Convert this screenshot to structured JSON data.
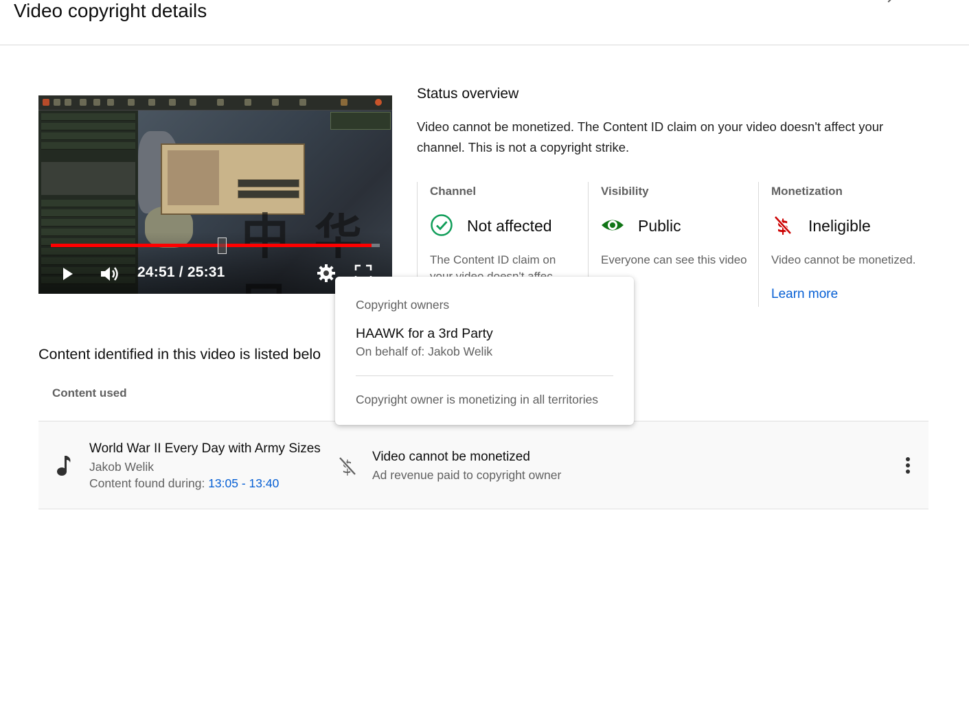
{
  "header": {
    "title": "Video copyright details"
  },
  "player": {
    "time_display": "24:51 / 25:31",
    "progress_fraction": 0.974,
    "handle_fraction": 0.52,
    "map_overlay_text": "中 华 民"
  },
  "status": {
    "title": "Status overview",
    "description": "Video cannot be monetized. The Content ID claim on your video doesn't affect your channel. This is not a copyright strike.",
    "columns": [
      {
        "label": "Channel",
        "value": "Not affected",
        "icon": "check-circle-icon",
        "color": "#0f9d58",
        "description": "The Content ID claim on your video doesn't affec"
      },
      {
        "label": "Visibility",
        "value": "Public",
        "icon": "eye-icon",
        "color": "#107516",
        "description": "Everyone can see this video"
      },
      {
        "label": "Monetization",
        "value": "Ineligible",
        "icon": "no-money-icon",
        "color": "#cc0000",
        "description": "Video cannot be monetized.",
        "link": "Learn more"
      }
    ]
  },
  "content": {
    "heading": "Content identified in this video is listed belo",
    "column_header": "Content used",
    "rows": [
      {
        "title": "World War II Every Day with Army Sizes",
        "artist": "Jakob Welik",
        "found_label": "Content found during:",
        "found_range": "13:05 - 13:40",
        "status": "Video cannot be monetized",
        "substatus": "Ad revenue paid to copyright owner"
      }
    ]
  },
  "popup": {
    "label": "Copyright owners",
    "owner": "HAAWK for a 3rd Party",
    "behalf": "On behalf of: Jakob Welik",
    "footer": "Copyright owner is monetizing in all territories"
  },
  "colors": {
    "link": "#065fd4",
    "progress": "#ff0000"
  }
}
